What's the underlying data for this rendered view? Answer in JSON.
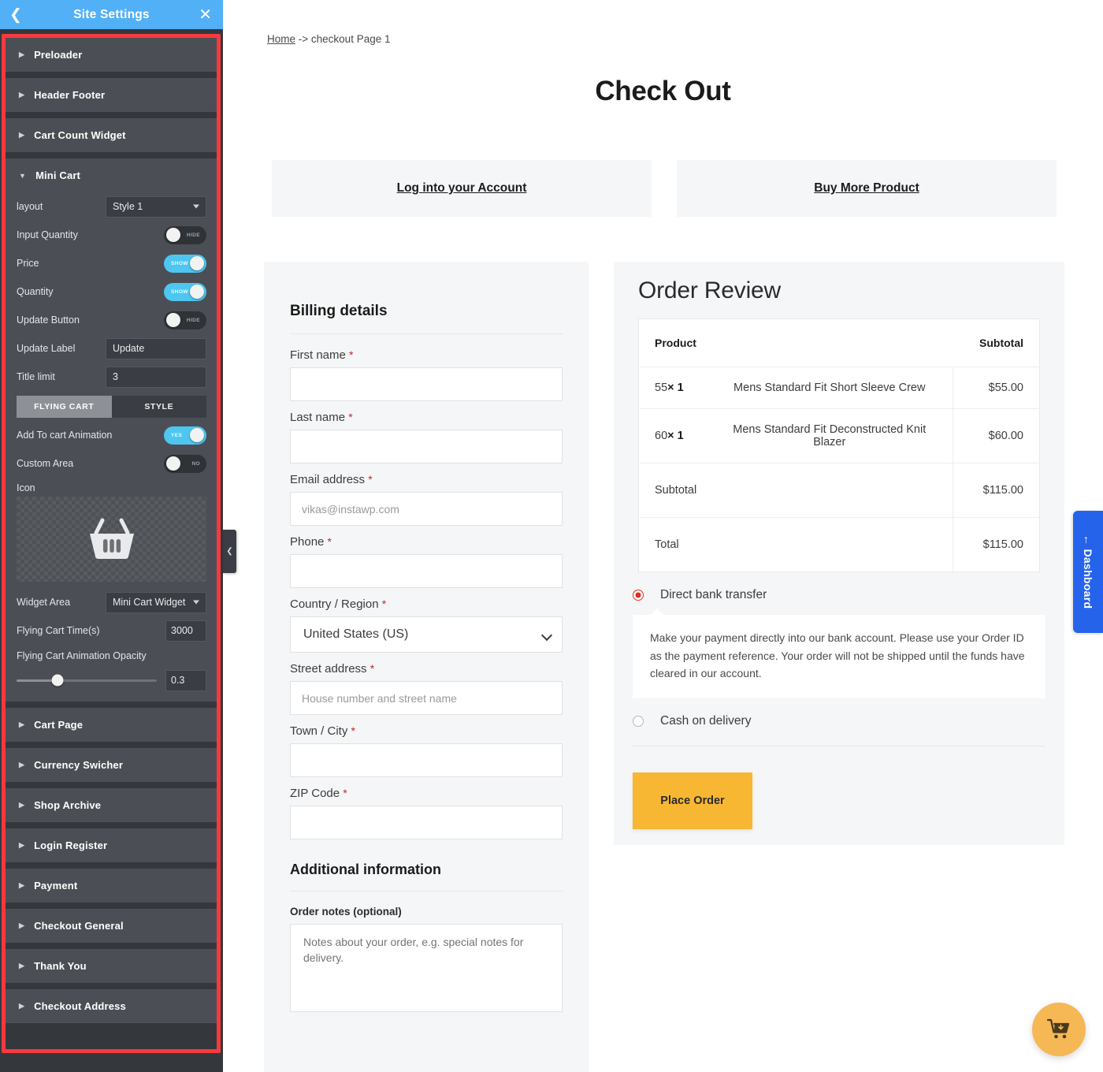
{
  "sidebar": {
    "header": {
      "title": "Site Settings",
      "back_icon": "chevron-left-icon",
      "close_icon": "close-icon"
    },
    "sections_before": [
      {
        "label": "Preloader"
      },
      {
        "label": "Header Footer"
      },
      {
        "label": "Cart Count Widget"
      }
    ],
    "mini_cart": {
      "label": "Mini Cart",
      "layout": {
        "label": "layout",
        "value": "Style 1"
      },
      "input_quantity": {
        "label": "Input Quantity",
        "state": "HIDE",
        "on": false
      },
      "price": {
        "label": "Price",
        "state": "SHOW",
        "on": true
      },
      "quantity": {
        "label": "Quantity",
        "state": "SHOW",
        "on": true
      },
      "update_button": {
        "label": "Update Button",
        "state": "HIDE",
        "on": false
      },
      "update_label": {
        "label": "Update Label",
        "value": "Update"
      },
      "title_limit": {
        "label": "Title limit",
        "value": "3"
      },
      "tabs": [
        {
          "label": "FLYING CART",
          "active": true
        },
        {
          "label": "STYLE",
          "active": false
        }
      ],
      "add_to_cart_animation": {
        "label": "Add To cart Animation",
        "state": "YES",
        "on": true
      },
      "custom_area": {
        "label": "Custom Area",
        "state": "NO",
        "on": false
      },
      "icon": {
        "label": "Icon",
        "icon_name": "shopping-basket-icon"
      },
      "widget_area": {
        "label": "Widget Area",
        "value": "Mini Cart Widget"
      },
      "flying_cart_time": {
        "label": "Flying Cart Time(s)",
        "value": "3000"
      },
      "flying_cart_opacity": {
        "label": "Flying Cart Animation Opacity",
        "value": "0.3"
      }
    },
    "sections_after": [
      {
        "label": "Cart Page"
      },
      {
        "label": "Currency Swicher"
      },
      {
        "label": "Shop Archive"
      },
      {
        "label": "Login Register"
      },
      {
        "label": "Payment"
      },
      {
        "label": "Checkout General"
      },
      {
        "label": "Thank You"
      },
      {
        "label": "Checkout Address"
      }
    ],
    "collapse_handle_icon": "chevron-left-icon",
    "highlight_color": "#f9393f",
    "header_color": "#52b0f7"
  },
  "main": {
    "breadcrumb": {
      "home": "Home",
      "separator": " -> ",
      "current": "checkout Page 1"
    },
    "page_title": "Check Out",
    "cta": [
      {
        "label": "Log into your Account"
      },
      {
        "label": "Buy More Product"
      }
    ],
    "billing": {
      "title": "Billing details",
      "fields": [
        {
          "label": "First name",
          "required": true,
          "value": "",
          "placeholder": ""
        },
        {
          "label": "Last name",
          "required": true,
          "value": "",
          "placeholder": ""
        },
        {
          "label": "Email address",
          "required": true,
          "value": "",
          "placeholder": "vikas@instawp.com"
        },
        {
          "label": "Phone",
          "required": true,
          "value": "",
          "placeholder": ""
        }
      ],
      "country": {
        "label": "Country / Region",
        "required": true,
        "value": "United States (US)"
      },
      "street": {
        "label": "Street address",
        "required": true,
        "placeholder": "House number and street name"
      },
      "town": {
        "label": "Town / City",
        "required": true,
        "placeholder": ""
      },
      "zip": {
        "label": "ZIP Code",
        "required": true,
        "placeholder": ""
      },
      "additional_title": "Additional information",
      "notes_label": "Order notes (optional)",
      "notes_placeholder": "Notes about your order, e.g. special notes for delivery."
    },
    "order": {
      "title": "Order Review",
      "columns": {
        "product": "Product",
        "subtotal": "Subtotal"
      },
      "items": [
        {
          "qty_price": "55",
          "qty_sep": "× ",
          "qty": "1",
          "name": "Mens Standard Fit Short Sleeve Crew",
          "amount": "$55.00"
        },
        {
          "qty_price": "60",
          "qty_sep": "× ",
          "qty": "1",
          "name": "Mens Standard Fit Deconstructed Knit Blazer",
          "amount": "$60.00"
        }
      ],
      "subtotal": {
        "label": "Subtotal",
        "amount": "$115.00"
      },
      "total": {
        "label": "Total",
        "amount": "$115.00"
      }
    },
    "payment": {
      "options": [
        {
          "label": "Direct bank transfer",
          "selected": true
        },
        {
          "label": "Cash on delivery",
          "selected": false
        }
      ],
      "description": "Make your payment directly into our bank account. Please use your Order ID as the payment reference. Your order will not be shipped until the funds have cleared in our account.",
      "place_order_label": "Place Order",
      "button_color": "#f7b733"
    },
    "dashboard_tab": {
      "label": "← Dashboard",
      "color": "#2563eb"
    },
    "floating_cart": {
      "icon_name": "shopping-cart-icon",
      "color": "#f6b755"
    }
  }
}
